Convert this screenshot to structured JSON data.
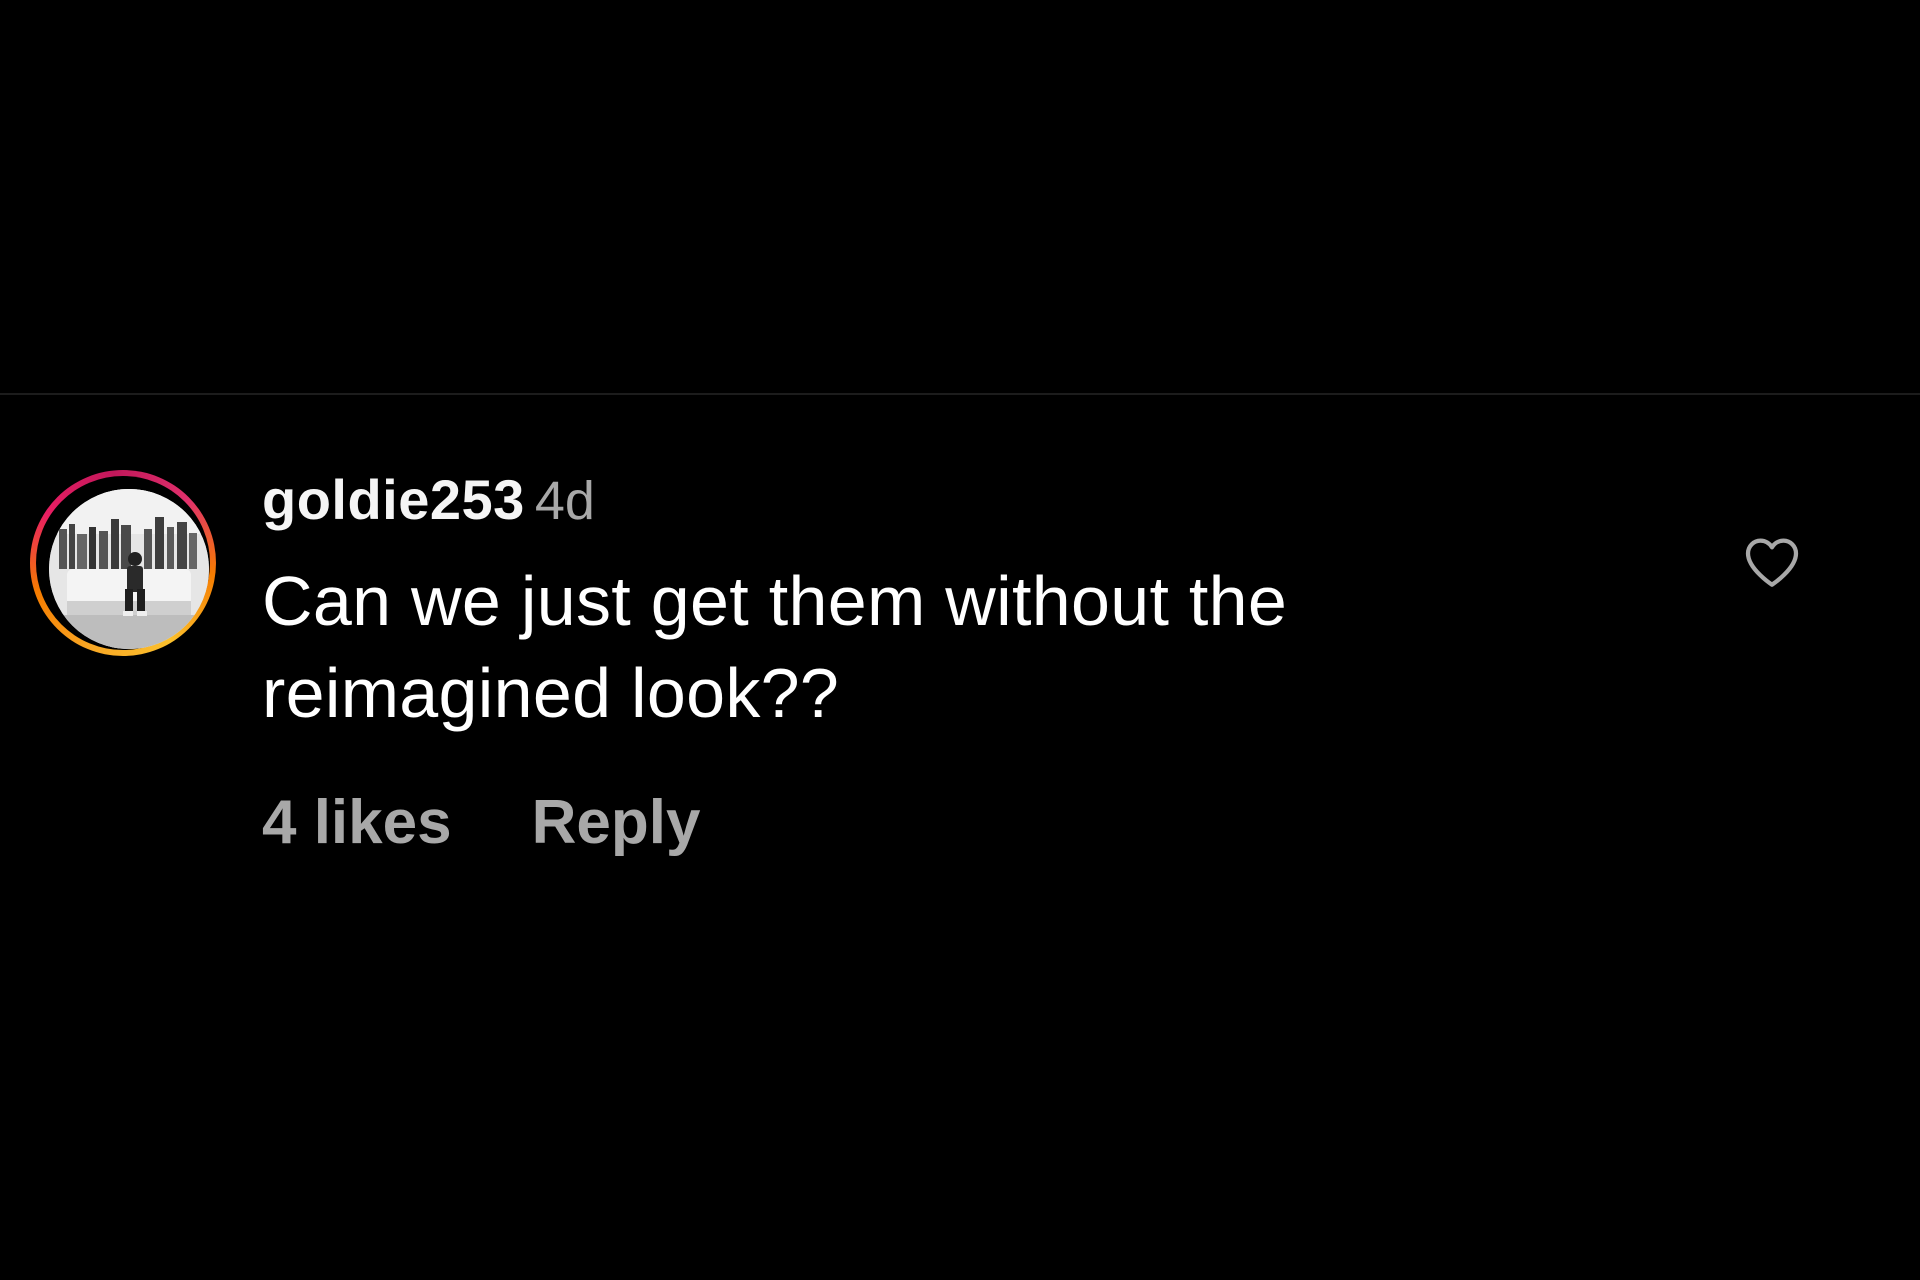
{
  "comment": {
    "username": "goldie253",
    "timestamp": "4d",
    "text": "Can we just get them without the reimagined look??",
    "likes_label": "4 likes",
    "reply_label": "Reply",
    "liked": false
  },
  "icons": {
    "like": "heart-outline-icon"
  },
  "colors": {
    "background": "#000000",
    "primary_text": "#ffffff",
    "secondary_text": "#a8a8a8",
    "story_ring_start": "#f9a825",
    "story_ring_end": "#e1306c"
  }
}
